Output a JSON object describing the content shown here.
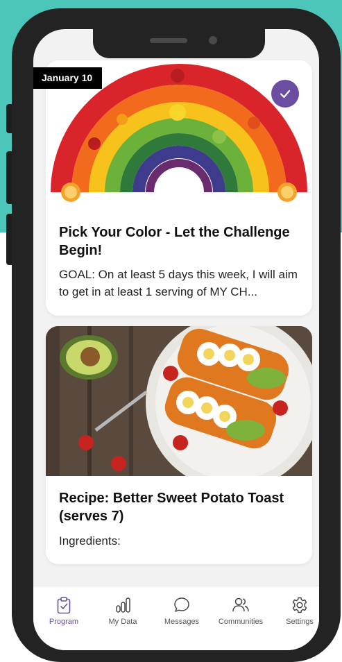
{
  "colors": {
    "teal": "#4cc6b8",
    "accent": "#6b4ea1",
    "phone": "#232323"
  },
  "feed": [
    {
      "date": "January 10",
      "completed": true,
      "image": "rainbow-vegetables",
      "title": "Pick Your Color - Let the Challenge Begin!",
      "description": "GOAL: On at least 5 days this week, I will aim to get in at least 1 serving of MY CH..."
    },
    {
      "image": "sweet-potato-toast",
      "title": "Recipe: Better Sweet Potato Toast (serves 7)",
      "description": "Ingredients:"
    }
  ],
  "tabbar": {
    "active": "Program",
    "tabs": [
      {
        "label": "Program",
        "icon": "clipboard-check-icon"
      },
      {
        "label": "My Data",
        "icon": "bar-chart-icon"
      },
      {
        "label": "Messages",
        "icon": "chat-bubble-icon"
      },
      {
        "label": "Communities",
        "icon": "people-icon"
      },
      {
        "label": "Settings",
        "icon": "gear-icon"
      }
    ]
  }
}
